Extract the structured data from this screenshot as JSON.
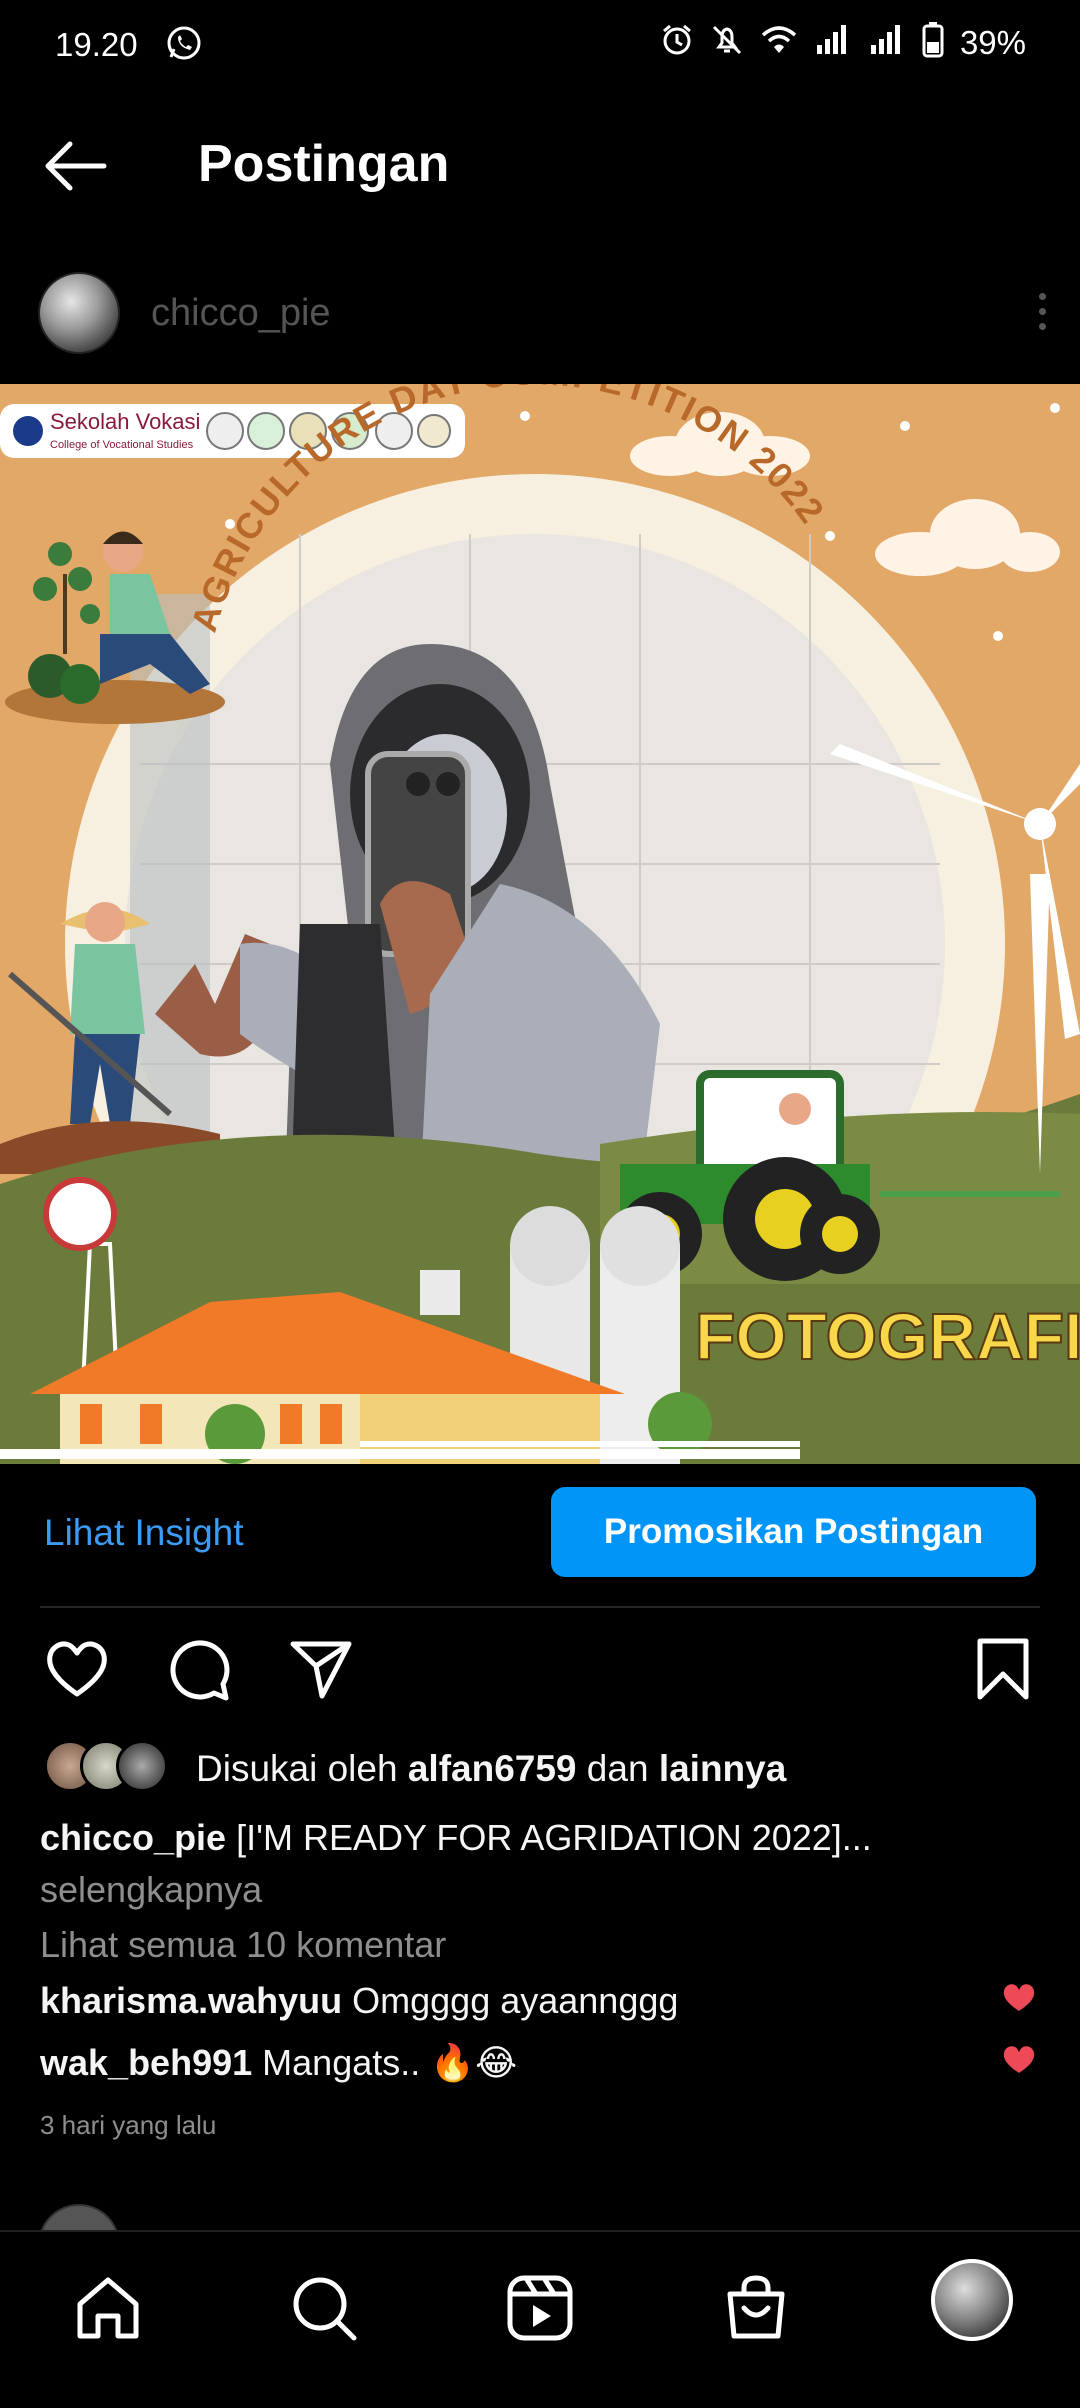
{
  "status_bar": {
    "time": "19.20",
    "battery": "39%"
  },
  "header": {
    "title": "Postingan"
  },
  "post": {
    "username": "chicco_pie",
    "image": {
      "banner": "AGRICULTURE DAY COMPETITION 2022",
      "category": "FOTOGRAFI",
      "logo_title": "Sekolah Vokasi",
      "logo_subtitle": "College of Vocational Studies"
    },
    "insight_label": "Lihat Insight",
    "promote_label": "Promosikan Postingan",
    "likes": {
      "prefix": "Disukai oleh",
      "user": "alfan6759",
      "conj": "dan",
      "others": "lainnya"
    },
    "caption": {
      "user": "chicco_pie",
      "text": "[I'M READY FOR AGRIDATION 2022]...",
      "more": "selengkapnya"
    },
    "view_all_comments": "Lihat semua 10 komentar",
    "comments": [
      {
        "user": "kharisma.wahyuu",
        "text": "Omgggg ayaannggg"
      },
      {
        "user": "wak_beh991",
        "text": "Mangats.. 🔥😂"
      }
    ],
    "time_ago": "3 hari yang lalu"
  },
  "colors": {
    "accent": "#0095f6",
    "link": "#3b9bf5",
    "like": "#ed4956",
    "muted": "#8e8e8e"
  },
  "icons": [
    "whatsapp-icon",
    "alarm-icon",
    "mute-icon",
    "wifi-icon",
    "signal-icon",
    "battery-icon",
    "back-arrow-icon",
    "more-icon",
    "heart-icon",
    "comment-icon",
    "share-icon",
    "bookmark-icon",
    "home-icon",
    "search-icon",
    "reels-icon",
    "shop-icon"
  ]
}
